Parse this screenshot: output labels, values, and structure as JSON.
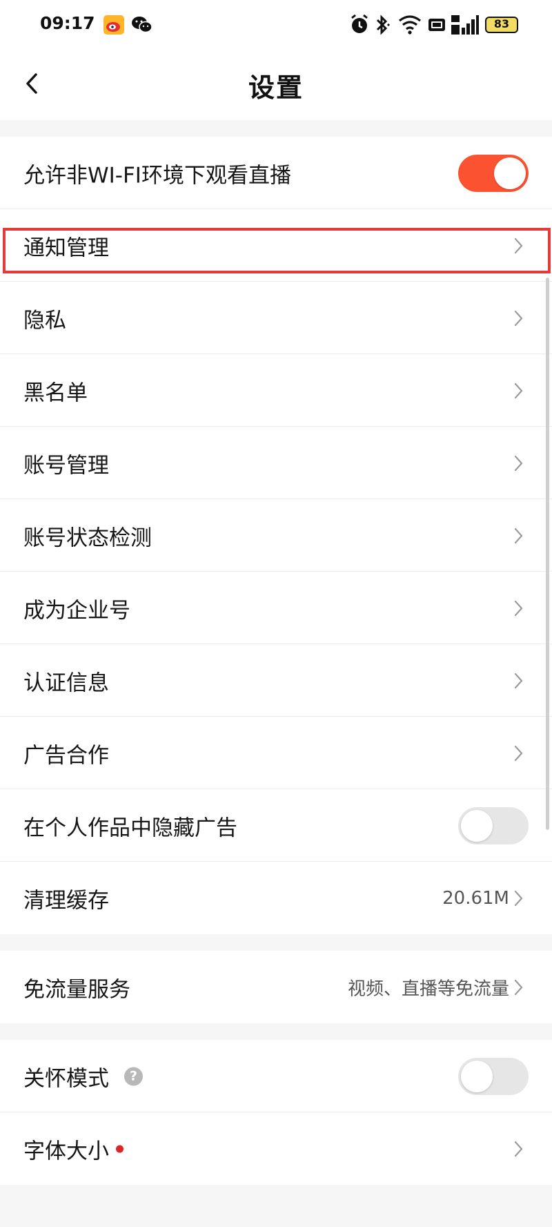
{
  "status_bar": {
    "time": "09:17",
    "battery": "83",
    "left_icons": [
      "weibo-icon",
      "wechat-icon"
    ],
    "right_icons": [
      "alarm-icon",
      "bluetooth-icon",
      "wifi-icon",
      "hd-icon",
      "signal-5g-icon",
      "battery-icon"
    ]
  },
  "nav": {
    "title": "设置"
  },
  "rows": {
    "wifi_live": {
      "label": "允许非WI-FI环境下观看直播",
      "enabled": true
    },
    "notification": {
      "label": "通知管理"
    },
    "privacy": {
      "label": "隐私"
    },
    "blacklist": {
      "label": "黑名单"
    },
    "account_mgmt": {
      "label": "账号管理"
    },
    "account_status": {
      "label": "账号状态检测"
    },
    "enterprise": {
      "label": "成为企业号"
    },
    "verification": {
      "label": "认证信息"
    },
    "ad_coop": {
      "label": "广告合作"
    },
    "hide_ads": {
      "label": "在个人作品中隐藏广告",
      "enabled": false
    },
    "clear_cache": {
      "label": "清理缓存",
      "value": "20.61M"
    },
    "free_data": {
      "label": "免流量服务",
      "value": "视频、直播等免流量"
    },
    "care_mode": {
      "label": "关怀模式",
      "enabled": false,
      "help_glyph": "?"
    },
    "font_size": {
      "label": "字体大小"
    }
  },
  "colors": {
    "accent": "#fb5331",
    "highlight": "#e63a3a",
    "red_dot": "#e02424"
  }
}
